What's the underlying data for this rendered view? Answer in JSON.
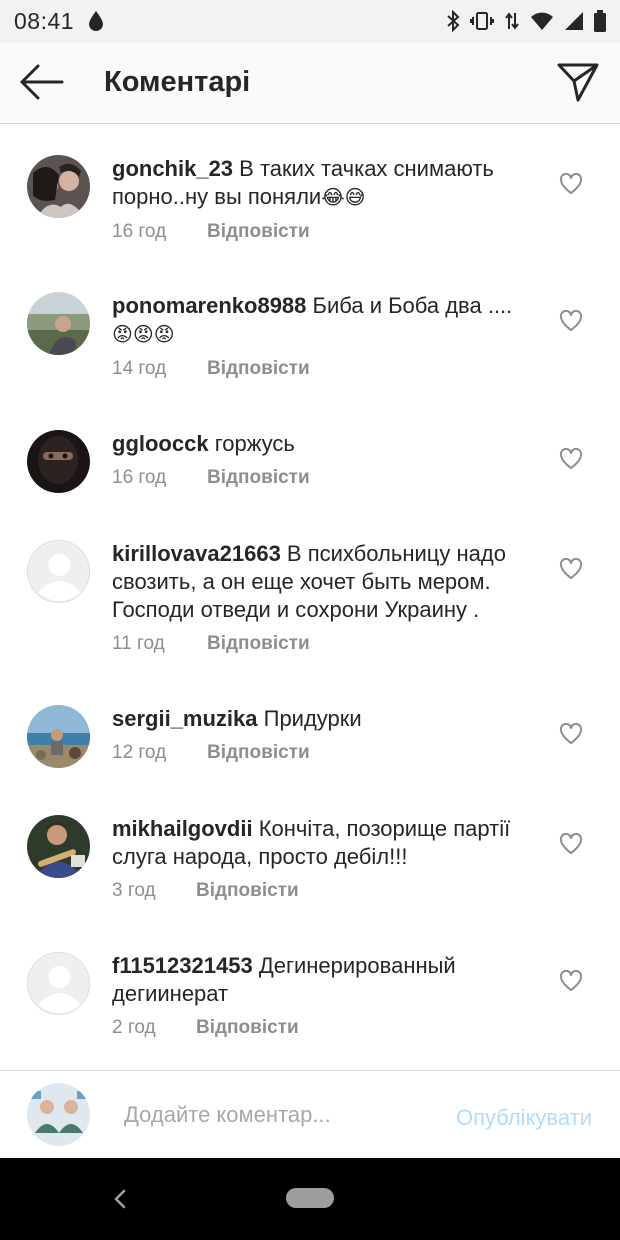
{
  "status_bar": {
    "time": "08:41",
    "icons": [
      "water-drop-icon",
      "bluetooth-icon",
      "vibrate-icon",
      "data-arrows-icon",
      "wifi-icon",
      "cell-signal-icon",
      "battery-icon"
    ]
  },
  "header": {
    "title": "Коментарі",
    "back_icon": "arrow-left-icon",
    "share_icon": "paper-plane-icon"
  },
  "comments": [
    {
      "username": "gonchik_23",
      "text": " В таких тачках снимають порно..ну вы поняли",
      "emoji": "😂😅",
      "time": "16 год",
      "reply": "Відповісти",
      "avatar": "photo-couple"
    },
    {
      "username": "ponomarenko8988",
      "text": " Биба и Боба два ....",
      "emoji": "😡😡😡",
      "time": "14 год",
      "reply": "Відповісти",
      "avatar": "photo-outdoor"
    },
    {
      "username": "ggloocck",
      "text": " горжусь",
      "emoji": "",
      "time": "16 год",
      "reply": "Відповісти",
      "avatar": "photo-balaclava"
    },
    {
      "username": "kirillovava21663",
      "text": " В психбольницу надо свозить, а он еще хочет быть мером. Господи отведи и сохрони Украину .",
      "emoji": "",
      "time": "11 год",
      "reply": "Відповісти",
      "avatar": "default-avatar"
    },
    {
      "username": "sergii_muzika",
      "text": " Придурки",
      "emoji": "",
      "time": "12 год",
      "reply": "Відповісти",
      "avatar": "photo-beach"
    },
    {
      "username": "mikhailgovdii",
      "text": " Кончіта, позорище партії слуга народа, просто дебіл!!!",
      "emoji": "",
      "time": "3 год",
      "reply": "Відповісти",
      "avatar": "photo-guitar"
    },
    {
      "username": "f11512321453",
      "text": " Дегинерированный дегиинерат",
      "emoji": "",
      "time": "2 год",
      "reply": "Відповісти",
      "avatar": "default-avatar"
    }
  ],
  "add_comment": {
    "placeholder": "Додайте коментар...",
    "post_label": "Опублікувати",
    "post_color": "#b3dbff"
  },
  "nav_bar": {
    "icons": [
      "nav-back-icon",
      "home-pill-icon"
    ]
  },
  "colors": {
    "text": "#262626",
    "secondary": "#8e8e8e",
    "divider": "#dbdbdb"
  }
}
